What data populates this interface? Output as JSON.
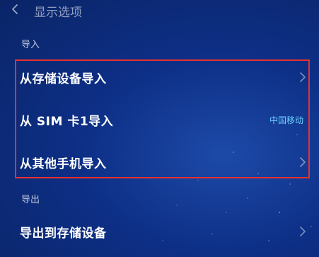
{
  "header": {
    "title": "显示选项",
    "back_icon": "back-arrow-icon"
  },
  "import_section": {
    "heading": "导入",
    "items": [
      {
        "label": "从存储设备导入",
        "value": "",
        "icon": "chevron-right-icon"
      },
      {
        "label": "从 SIM 卡1导入",
        "value": "中国移动",
        "icon": ""
      },
      {
        "label": "从其他手机导入",
        "value": "",
        "icon": "chevron-right-icon"
      }
    ]
  },
  "export_section": {
    "heading": "导出",
    "items": [
      {
        "label": "导出到存储设备",
        "value": "",
        "icon": "chevron-right-icon"
      }
    ]
  },
  "colors": {
    "highlight_border": "#e8302f",
    "value_text": "#6fd0ff",
    "background": "#0d2f86"
  }
}
